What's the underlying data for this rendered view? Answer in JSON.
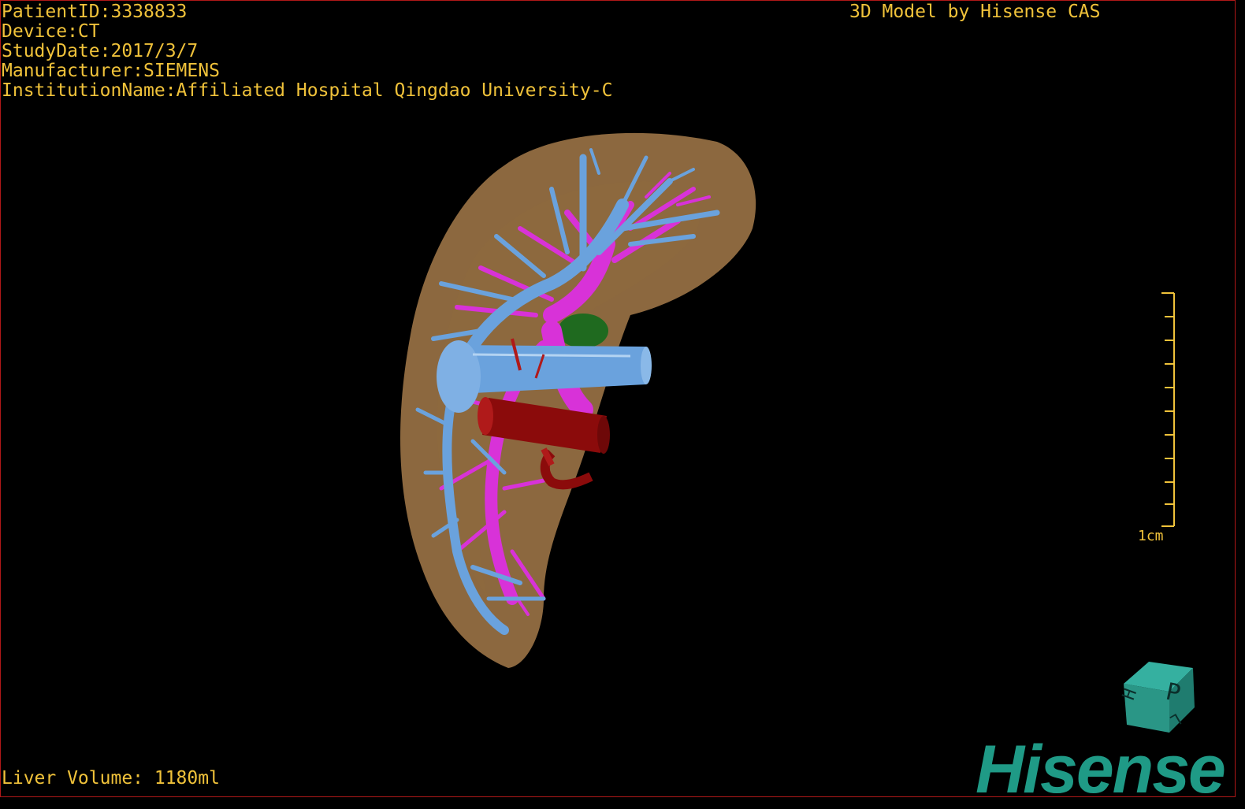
{
  "header": {
    "patient_id": "PatientID:3338833",
    "device": "Device:CT",
    "study_date": "StudyDate:2017/3/7",
    "manufacturer": "Manufacturer:SIEMENS",
    "institution": "InstitutionName:Affiliated Hospital Qingdao University-C"
  },
  "credit": "3D Model by Hisense CAS",
  "scale": {
    "label": "1cm"
  },
  "footer": {
    "volume": "Liver Volume: 1180ml"
  },
  "brand": {
    "logo_text": "Hisense"
  },
  "orientation_cube": {
    "face_letters": [
      "P",
      "H",
      "L"
    ]
  },
  "colors": {
    "text": "#f0c23a",
    "liver": "#a57a4a",
    "portal_vein": "#6aa2dd",
    "hepatic_vein": "#d832d8",
    "artery": "#8b0b0b",
    "gallbladder": "#1f6a1f",
    "brand": "#1f9a86"
  },
  "icons": [
    "orientation-cube-icon",
    "scale-bar-icon"
  ]
}
